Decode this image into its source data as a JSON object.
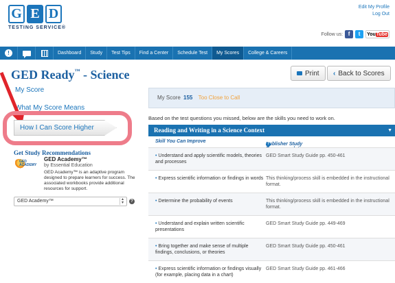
{
  "header": {
    "logo_letters": [
      "G",
      "E",
      "D"
    ],
    "logo_sub": "TESTING SERVICE",
    "edit_profile": "Edit My Profile",
    "logout": "Log Out",
    "follow_us": "Follow us:",
    "facebook_glyph": "f",
    "twitter_glyph": "t",
    "youtube_you": "You",
    "youtube_tube": "Tube"
  },
  "nav": {
    "alert_glyph": "!",
    "items": [
      "Dashboard",
      "Study",
      "Test Tips",
      "Find a Center",
      "Schedule Test",
      "My Scores",
      "College & Careers"
    ],
    "active_index": 5
  },
  "page": {
    "title": "GED Ready",
    "title_tm": "™",
    "title_suffix": " - Science",
    "print_label": "Print",
    "back_label": "Back to Scores"
  },
  "sidebar": {
    "my_score": "My Score",
    "what_means": "What My Score Means",
    "score_higher": "How I Can Score Higher",
    "rec_heading": "Get Study Recommendations",
    "rec_logo_text": "GED ACADEMY",
    "rec_name": "GED Academy™",
    "rec_by": "by Essential Education",
    "rec_desc": "GED Academy™ is an adaptive program designed to prepare learners for success. The associated workbooks provide additional resources for support.",
    "select_value": "GED Academy™",
    "help_glyph": "?"
  },
  "score": {
    "label": "My Score",
    "value": "155",
    "status": "Too Close to Call"
  },
  "intro": "Based on the test questions you missed, below are the skills you need to work on.",
  "section": {
    "title": "Reading and Writing in a Science Context",
    "col_skill": "Skill You Can Improve",
    "col_rec": "Publisher Study Recommendations",
    "rows": [
      {
        "skill": "Understand and apply scientific models, theories and processes",
        "rec": "GED Smart Study Guide pp. 450-461"
      },
      {
        "skill": "Express scientific information or findings in words",
        "rec": "This thinking/process skill is embedded in the instructional format."
      },
      {
        "skill": "Determine the probability of events",
        "rec": "This thinking/process skill is embedded in the instructional format."
      },
      {
        "skill": "Understand and explain written scientific presentations",
        "rec": "GED Smart Study Guide pp. 449-469"
      },
      {
        "skill": "Bring together and make sense of multiple findings, conclusions, or theories",
        "rec": "GED Smart Study Guide pp. 450-461"
      },
      {
        "skill": "Express scientific information or findings visually (for example, placing data in a chart)",
        "rec": "GED Smart Study Guide pp. 461-466"
      }
    ]
  },
  "colors": {
    "brand_blue": "#1a72b1",
    "highlight_pink": "#ee7c8a",
    "arrow_red": "#e0242b",
    "status_orange": "#f1a13a"
  }
}
